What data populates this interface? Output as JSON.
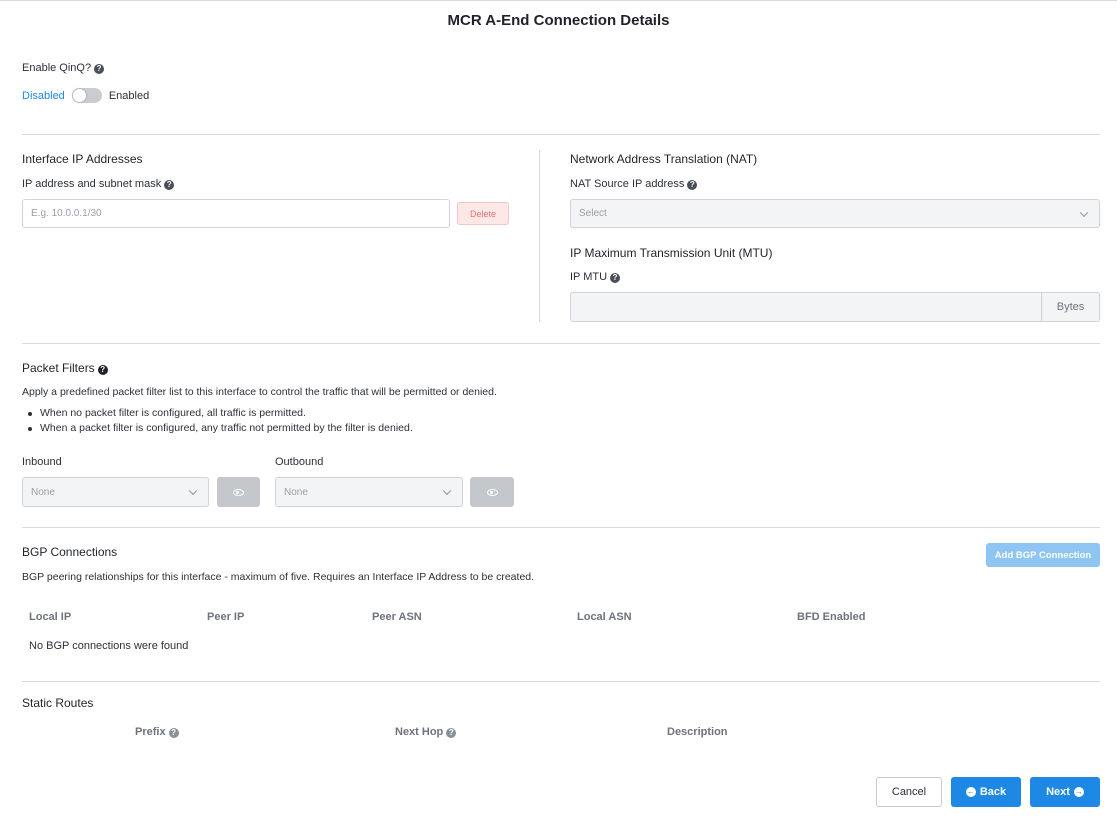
{
  "page_title": "MCR A-End Connection Details",
  "qinq": {
    "label": "Enable QinQ?",
    "help_icon": "?",
    "off_label": "Disabled",
    "on_label": "Enabled",
    "enabled": false
  },
  "interface_ip": {
    "heading": "Interface IP Addresses",
    "field_label": "IP address and subnet mask",
    "placeholder": "E.g. 10.0.0.1/30",
    "delete_label": "Delete"
  },
  "nat": {
    "heading": "Network Address Translation (NAT)",
    "field_label": "NAT Source IP address",
    "select_value": "Select"
  },
  "mtu": {
    "heading": "IP Maximum Transmission Unit (MTU)",
    "field_label": "IP MTU",
    "value": "",
    "unit": "Bytes"
  },
  "packet_filters": {
    "heading": "Packet Filters",
    "description": "Apply a predefined packet filter list to this interface to control the traffic that will be permitted or denied.",
    "bullets": [
      "When no packet filter is configured, all traffic is permitted.",
      "When a packet filter is configured, any traffic not permitted by the filter is denied."
    ],
    "inbound_label": "Inbound",
    "inbound_value": "None",
    "outbound_label": "Outbound",
    "outbound_value": "None"
  },
  "bgp": {
    "heading": "BGP Connections",
    "add_button": "Add BGP Connection",
    "description": "BGP peering relationships for this interface - maximum of five. Requires an Interface IP Address to be created.",
    "columns": [
      "Local IP",
      "Peer IP",
      "Peer ASN",
      "Local ASN",
      "BFD Enabled"
    ],
    "empty_message": "No BGP connections were found"
  },
  "static_routes": {
    "heading": "Static Routes",
    "columns": [
      "Prefix",
      "Next Hop",
      "Description"
    ]
  },
  "footer": {
    "cancel": "Cancel",
    "back": "Back",
    "next": "Next"
  },
  "colors": {
    "accent": "#1e88e5",
    "delete_bg": "#fde8e8",
    "delete_text": "#e57373",
    "disabled_blue": "#8ec5f2"
  }
}
